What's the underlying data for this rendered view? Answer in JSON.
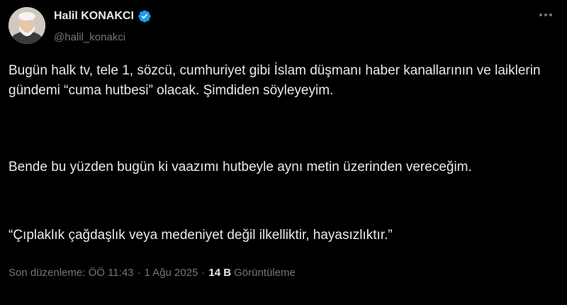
{
  "author": {
    "name": "Halil KONAKCI",
    "handle": "@halil_konakci",
    "verified": true,
    "verified_color": "#1d9bf0",
    "avatar_icon": "profile-photo"
  },
  "tweet": {
    "paragraphs": [
      "Bugün halk tv, tele 1, sözcü, cumhuriyet gibi İslam düşmanı haber kanallarının ve laiklerin gündemi “cuma hutbesi” olacak. Şimdiden söyleyeyim.",
      "Bende bu yüzden bugün ki vaazımı hutbeyle aynı metin üzerinden vereceğim.",
      "“Çıplaklık çağdaşlık veya medeniyet değil ilkelliktir, hayasızlıktır.”"
    ]
  },
  "meta": {
    "edited_label": "Son düzenleme: ÖÖ 11:43",
    "separator1": "·",
    "date": "1 Ağu 2025",
    "separator2": "·",
    "views_count": "14 B",
    "views_label": "Görüntüleme"
  },
  "icons": {
    "more": "more-dots-icon",
    "verified": "verified-badge-icon"
  }
}
